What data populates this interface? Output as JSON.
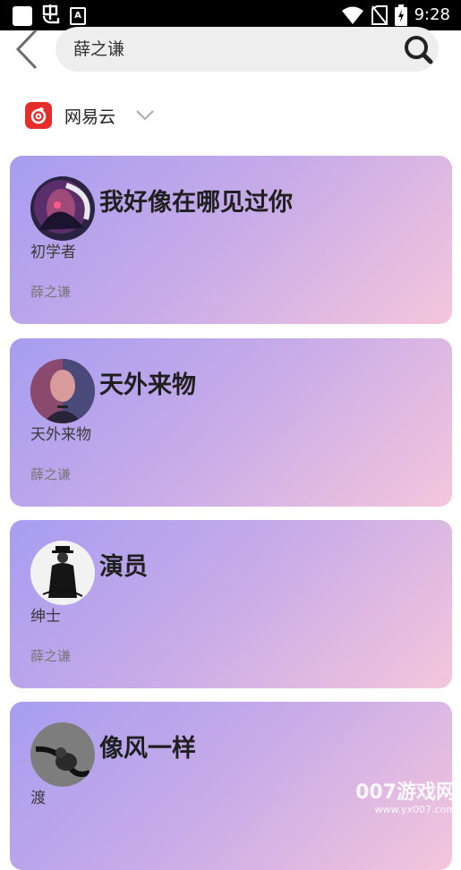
{
  "status_bar": {
    "time": "9:28",
    "left_icons": [
      "white-square-icon",
      "bug-icon",
      "a-icon"
    ],
    "right_icons": [
      "wifi-icon",
      "no-sim-icon",
      "battery-icon"
    ]
  },
  "header": {
    "back_icon": "chevron-left-icon",
    "search": {
      "value": "薛之谦",
      "icon": "search-icon"
    }
  },
  "source_selector": {
    "label": "网易云",
    "logo": "netease-cloud-music-logo",
    "brand_color": "#e72d2c",
    "chevron": "chevron-down-icon"
  },
  "colors": {
    "card_gradient": [
      "#a79df0",
      "#c7abe8",
      "#f5c6dc"
    ]
  },
  "results": [
    {
      "title": "我好像在哪见过你",
      "album": "初学者",
      "artist": "薛之谦"
    },
    {
      "title": "天外来物",
      "album": "天外来物",
      "artist": "薛之谦"
    },
    {
      "title": "演员",
      "album": "绅士",
      "artist": "薛之谦"
    },
    {
      "title": "像风一样",
      "album": "渡",
      "artist": ""
    }
  ],
  "watermark": {
    "main": "007游戏网",
    "url": "www.yx007.com"
  }
}
